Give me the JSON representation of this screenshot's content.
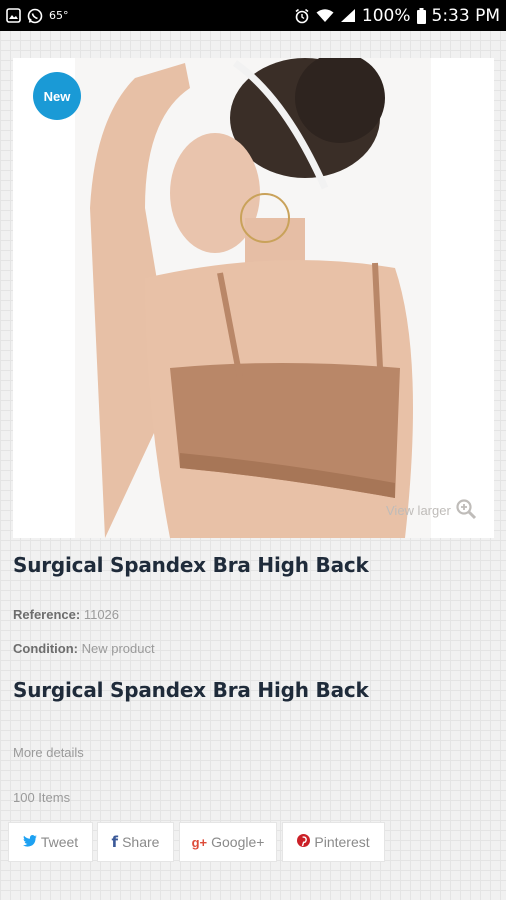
{
  "status_bar": {
    "temperature": "65°",
    "battery": "100%",
    "time": "5:33 PM"
  },
  "product": {
    "badge": "New",
    "view_larger": "View larger",
    "title": "Surgical Spandex Bra High Back",
    "reference_label": "Reference:",
    "reference_value": "11026",
    "condition_label": "Condition:",
    "condition_value": "New product",
    "title_repeat": "Surgical Spandex Bra High Back",
    "more_details": "More details",
    "quantity": "100 Items"
  },
  "share": {
    "tweet": "Tweet",
    "share": "Share",
    "google": "Google+",
    "pinterest": "Pinterest"
  },
  "colors": {
    "badge": "#1a9ad6",
    "twitter": "#1da1f2",
    "facebook": "#3b5998",
    "google": "#dd4b39",
    "pinterest": "#cb2027"
  }
}
